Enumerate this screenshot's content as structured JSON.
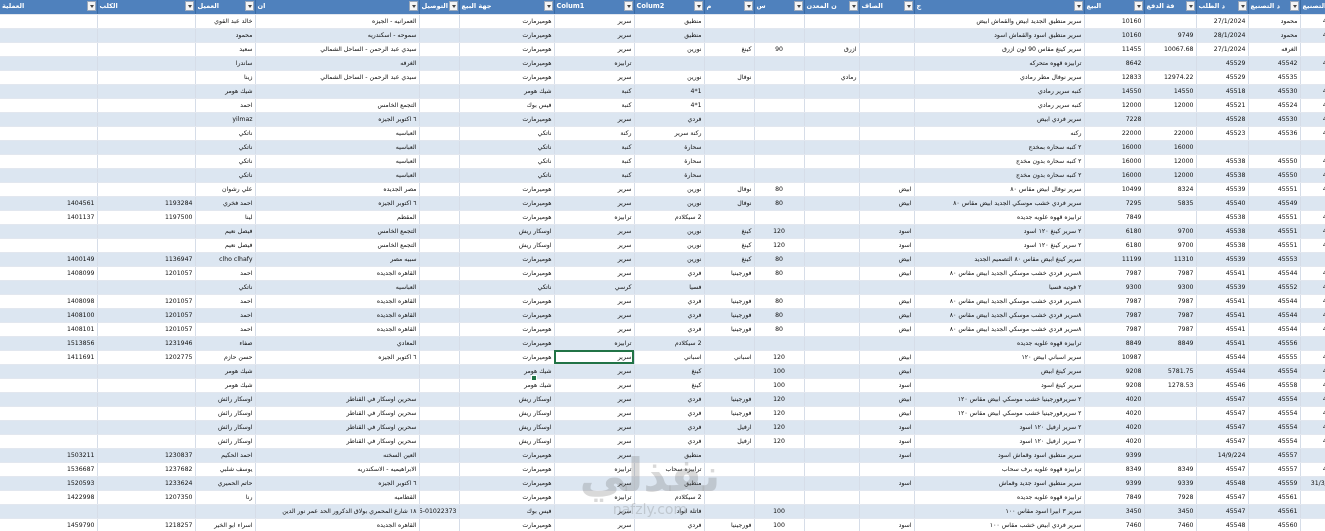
{
  "headers": [
    "العملية",
    "الكلب",
    "العميل",
    "ان",
    "التوصيل",
    "جهة البيع",
    "Colum1",
    "Colum2",
    "م",
    "س",
    "ن المعدن",
    "الصاف",
    "ج",
    "البيع",
    "فة الدفع",
    "د الطلب",
    "د التصنيع",
    "رقم التصنيع",
    "ع"
  ],
  "rows": [
    [
      "",
      "",
      "خالد عبد القوي",
      "العمرانيه - الجيزه",
      "",
      "هوميرمارت",
      "سرير",
      "منطيق",
      "",
      "",
      "",
      "",
      "سرير منطيق الجديد ابيض والقماش ابيض",
      "10160",
      "",
      "27/1/2024",
      "محمود",
      "45514",
      "ه شحن"
    ],
    [
      "",
      "",
      "محمود",
      "سموحه - اسكندريه",
      "",
      "هوميرمارت",
      "سرير",
      "منطيق",
      "",
      "",
      "",
      "",
      "سرير منطيق اسود والقماش اسود",
      "10160",
      "9749",
      "28/1/2024",
      "محمود",
      "45515",
      "ه شحن"
    ],
    [
      "",
      "",
      "سعيد",
      "سيدي عبد الرحمن - الساحل الشمالي",
      "",
      "هوميرمارت",
      "سرير",
      "نورين",
      "كينغ",
      "90",
      "ازرق",
      "",
      "سرير كينغ مقاس 90 لون ازرق",
      "11455",
      "10067.68",
      "27/1/2024",
      "الغرفه",
      "",
      "ه شحن"
    ],
    [
      "",
      "",
      "ساندرا",
      "الغرفه",
      "",
      "هوميرمارت",
      "ترابيزه",
      "",
      "",
      "",
      "",
      "",
      "ترابيزه قهوه متحركه",
      "8642",
      "",
      "45529",
      "45542",
      "45531",
      "ه شحن"
    ],
    [
      "",
      "",
      "زينا",
      "سيدي عبد الرحمن - الساحل الشمالي",
      "",
      "هوميرمارت",
      "سرير",
      "نورين",
      "نوفال",
      "",
      "رمادي",
      "",
      "سرير نوفال مطر رمادي",
      "12833",
      "12974.22",
      "45529",
      "45535",
      "",
      ""
    ],
    [
      "",
      "",
      "شيك هومر",
      "",
      "",
      "شيك هومر",
      "كنبة",
      "1*4",
      "",
      "",
      "",
      "",
      "كنبه سرير رمادي",
      "14550",
      "14550",
      "45518",
      "45530",
      "45540",
      "ه شحن"
    ],
    [
      "",
      "",
      "احمد",
      "التجمع الخامس",
      "",
      "فيس بوك",
      "كنبة",
      "1*4",
      "",
      "",
      "",
      "",
      "كنبه سرير رمادي",
      "12000",
      "12000",
      "45521",
      "45524",
      "45523",
      "شركه شحن"
    ],
    [
      "",
      "",
      "yilmaz",
      "٦ اكتوبر الجيزه",
      "",
      "هوميرمارت",
      "سرير",
      "فردي",
      "",
      "",
      "",
      "",
      "سرير فردي ابيض",
      "7228",
      "",
      "45528",
      "45530",
      "45545",
      "ه شحن"
    ],
    [
      "",
      "",
      "ناتكي",
      "العباسيه",
      "",
      "ناتكي",
      "ركنة",
      "ركنة سرير",
      "",
      "",
      "",
      "",
      "ركنه",
      "22000",
      "22000",
      "45523",
      "45536",
      "45552",
      ""
    ],
    [
      "",
      "",
      "ناتكي",
      "العباسيه",
      "",
      "ناتكي",
      "كنبة",
      "سحارة",
      "",
      "",
      "",
      "",
      "٢ كنبه سحاره بمخدج",
      "16000",
      "16000",
      "",
      "",
      "",
      ""
    ],
    [
      "",
      "",
      "ناتكي",
      "العباسيه",
      "",
      "ناتكي",
      "كنبة",
      "سحارة",
      "",
      "",
      "",
      "",
      "٢ كنبه سحاره بدون مخدج",
      "16000",
      "12000",
      "45538",
      "45550",
      "45552",
      ""
    ],
    [
      "",
      "",
      "ناتكي",
      "العباسيه",
      "",
      "ناتكي",
      "كنبة",
      "سحارة",
      "",
      "",
      "",
      "",
      "٢ كنبه سحاره بدون مخدج",
      "16000",
      "12000",
      "45538",
      "45550",
      "45552",
      ""
    ],
    [
      "",
      "",
      "علي رشوان",
      "مصر الجديده",
      "",
      "هوميرمارت",
      "سرير",
      "نورين",
      "نوفال",
      "80",
      "",
      "ابيض",
      "سرير نوفال ابيض مقاس ٨٠",
      "10499",
      "8324",
      "45539",
      "45551",
      "45543",
      "ه شحن"
    ],
    [
      "1404561",
      "1193284",
      "احمد فخري",
      "٦ اكتوبر الجيزه",
      "",
      "هوميرمارت",
      "سرير",
      "نورين",
      "نوفال",
      "80",
      "",
      "ابيض",
      "سرير فردي خشب موسكي الجديد ابيض مقاس ٨٠",
      "7295",
      "5835",
      "45540",
      "45549",
      "",
      ""
    ],
    [
      "1401137",
      "1197500",
      "لينا",
      "المقطم",
      "",
      "هوميرمارت",
      "ترابيزه",
      "2 سيكلادم",
      "",
      "",
      "",
      "",
      "ترابيزه قهوه علويه جديده",
      "7849",
      "",
      "45538",
      "45551",
      "45560",
      "ه شحن"
    ],
    [
      "",
      "",
      "فيصل نعيم",
      "التجمع الخامس",
      "",
      "اوسكار ريش",
      "سرير",
      "نورين",
      "كينغ",
      "120",
      "",
      "اسود",
      "٢ سرير كينغ ١٢٠ اسود",
      "6180",
      "9700",
      "45538",
      "45551",
      "45550",
      ""
    ],
    [
      "",
      "",
      "فيصل نعيم",
      "التجمع الخامس",
      "",
      "اوسكار ريش",
      "سرير",
      "نورين",
      "كينغ",
      "120",
      "",
      "اسود",
      "٢ سرير كينغ ١٢٠ اسود",
      "6180",
      "9700",
      "45538",
      "45551",
      "45550",
      ""
    ],
    [
      "1400149",
      "1136947",
      "clho clhafy",
      "سبيه مصر",
      "",
      "هوميرمارت",
      "سرير",
      "نورين",
      "كينغ",
      "80",
      "",
      "ابيض",
      "سرير كينغ ابيض مقاس ٨٠ التصميم الجديد",
      "11199",
      "11310",
      "45539",
      "45553",
      "",
      ""
    ],
    [
      "1408099",
      "1201057",
      "احمد",
      "القاهره الجديده",
      "",
      "هوميرمارت",
      "سرير",
      "فردي",
      "فورجينيا",
      "80",
      "",
      "ابيض",
      "٨سرير فردي خشب موسكي الجديد ابيض مقاس ٨٠",
      "7987",
      "7987",
      "45541",
      "45544",
      "45556",
      ""
    ],
    [
      "",
      "",
      "ناتكي",
      "العباسيه",
      "",
      "ناتكي",
      "كرسي",
      "فسيا",
      "",
      "",
      "",
      "",
      "٢ فوتيه فسيا",
      "9300",
      "9300",
      "45539",
      "45552",
      "45556",
      ""
    ],
    [
      "1408098",
      "1201057",
      "احمد",
      "القاهره الجديده",
      "",
      "هوميرمارت",
      "سرير",
      "فردي",
      "فورجينيا",
      "80",
      "",
      "ابيض",
      "٨سرير فردي خشب موسكي الجديد ابيض مقاس ٨٠",
      "7987",
      "7987",
      "45541",
      "45544",
      "45556",
      ""
    ],
    [
      "1408100",
      "1201057",
      "احمد",
      "القاهره الجديده",
      "",
      "هوميرمارت",
      "سرير",
      "فردي",
      "فورجينيا",
      "80",
      "",
      "ابيض",
      "٨سرير فردي خشب موسكي الجديد ابيض مقاس ٨٠",
      "7987",
      "7987",
      "45541",
      "45544",
      "45556",
      ""
    ],
    [
      "1408101",
      "1201057",
      "احمد",
      "القاهره الجديده",
      "",
      "هوميرمارت",
      "سرير",
      "فردي",
      "فورجينيا",
      "80",
      "",
      "ابيض",
      "٨سرير فردي خشب موسكي الجديد ابيض مقاس ٨٠",
      "7987",
      "7987",
      "45541",
      "45544",
      "45556",
      ""
    ],
    [
      "1513856",
      "1231946",
      "صفاء",
      "المعادي",
      "",
      "هوميرمارت",
      "ترابيزه",
      "2 سيكلادم",
      "",
      "",
      "",
      "",
      "ترابيزه قهوه علويه جديده",
      "8849",
      "8849",
      "45541",
      "45556",
      "",
      ""
    ],
    [
      "1411691",
      "1202775",
      "حسن حازم",
      "٦ اكتوبر الجيزه",
      "",
      "هوميرمارت",
      "سرير",
      "اسباني",
      "اسباني",
      "120",
      "",
      "ابيض",
      "سرير اسباني ابيض ١٢٠",
      "10987",
      "",
      "45544",
      "45555",
      "45556",
      ""
    ],
    [
      "",
      "",
      "شيك هومر",
      "",
      "",
      "شيك هومر",
      "سرير",
      "كينغ",
      "",
      "100",
      "",
      "ابيض",
      "سرير كينغ ابيض",
      "9208",
      "5781.75",
      "45544",
      "45554",
      "45556",
      ""
    ],
    [
      "",
      "",
      "شيك هومر",
      "",
      "",
      "شيك هومر",
      "سرير",
      "كينغ",
      "",
      "100",
      "",
      "اسود",
      "سرير كينغ اسود",
      "9208",
      "1278.53",
      "45546",
      "45558",
      "45556",
      ""
    ],
    [
      "",
      "",
      "اوسكار رائش",
      "سحرين اوسكار في القناطر",
      "",
      "اوسكار ريش",
      "سرير",
      "فردي",
      "فورجينيا",
      "120",
      "",
      "ابيض",
      "٢ سريرفورجينيا خشب موسكي ابيض مقاس ١٢٠",
      "4020",
      "",
      "45547",
      "45554",
      "45556",
      ""
    ],
    [
      "",
      "",
      "اوسكار رائش",
      "سحرين اوسكار في القناطر",
      "",
      "اوسكار ريش",
      "سرير",
      "فردي",
      "فورجينيا",
      "120",
      "",
      "ابيض",
      "٢ سريرفورجينيا خشب موسكي ابيض مقاس ١٢٠",
      "4020",
      "",
      "45547",
      "45554",
      "45556",
      ""
    ],
    [
      "",
      "",
      "اوسكار رائش",
      "سحرين اوسكار في القناطر",
      "",
      "اوسكار ريش",
      "سرير",
      "فردي",
      "ارفيل",
      "120",
      "",
      "اسود",
      "٢ سرير ارفيل ١٢٠ اسود",
      "4020",
      "",
      "45547",
      "45554",
      "45556",
      ""
    ],
    [
      "",
      "",
      "اوسكار رائش",
      "سحرين اوسكار في القناطر",
      "",
      "اوسكار ريش",
      "سرير",
      "فردي",
      "ارفيل",
      "120",
      "",
      "اسود",
      "٢ سرير ارفيل ١٢٠ اسود",
      "4020",
      "",
      "45547",
      "45554",
      "45556",
      ""
    ],
    [
      "1503211",
      "1230837",
      "احمد الحكيم",
      "العين السخنه",
      "",
      "هوميرمارت",
      "سرير",
      "منطيق",
      "",
      "",
      "",
      "اسود",
      "سرير منطيق اسود وقماش اسود",
      "9399",
      "",
      "14/9/224",
      "45557",
      "",
      "قتل التسليم"
    ],
    [
      "1536687",
      "1237682",
      "يوسف شلبي",
      "الابراهيميه - الاسكندريه",
      "",
      "هوميرمارت",
      "ترابيزه",
      "ترابيزه سحاب",
      "",
      "",
      "",
      "",
      "ترابيزه قهوه علويه برف سحاب",
      "8349",
      "8349",
      "45547",
      "45557",
      "45556",
      "ه شحن"
    ],
    [
      "1520593",
      "1233624",
      "حاتم الحميري",
      "٦ اكتوبر الجيزه",
      "",
      "هوميرمارت",
      "سرير",
      "منطيق",
      "",
      "",
      "",
      "اسود",
      "سرير منطيق اسود جديد وقماش",
      "9399",
      "9339",
      "45548",
      "45559",
      "31/3/2024",
      "ه شحن"
    ],
    [
      "1422998",
      "1207350",
      "رنا",
      "القطاميه",
      "",
      "هوميرمارت",
      "ترابيزه",
      "2 سيكلادم",
      "",
      "",
      "",
      "",
      "ترابيزه قهوه علويه جديده",
      "7849",
      "7928",
      "45547",
      "45561",
      "",
      "تم التسليم عن طرح"
    ],
    [
      "",
      "",
      "",
      "١٨ شارع المحمري بولاق الدكرور الحد عمر نور الدين",
      "01229328475-01022373",
      "فيس بوك",
      "سرير",
      "فاتلة انواد",
      "",
      "100",
      "",
      "",
      "سرير ٣ ابيرا اسود مقاس ١٠٠",
      "3450",
      "3450",
      "45547",
      "45561",
      "",
      ""
    ],
    [
      "1459790",
      "1218257",
      "اسراء ابو الخير",
      "القاهره الجديده",
      "",
      "هوميرمارت",
      "سرير",
      "فردي",
      "فورجينيا",
      "100",
      "",
      "اسود",
      "سرير فردي ابيض خشب مقاس ١٠٠",
      "7460",
      "7460",
      "45548",
      "45560",
      "",
      ""
    ]
  ],
  "selected_cell": {
    "row": 26,
    "col": "Colum1"
  },
  "watermark": {
    "word": "نفذلي",
    "url": "nafzly.com"
  },
  "colors": {
    "header_bg": "#4f81bd",
    "band_bg": "#dce6f1",
    "selection": "#217346"
  }
}
